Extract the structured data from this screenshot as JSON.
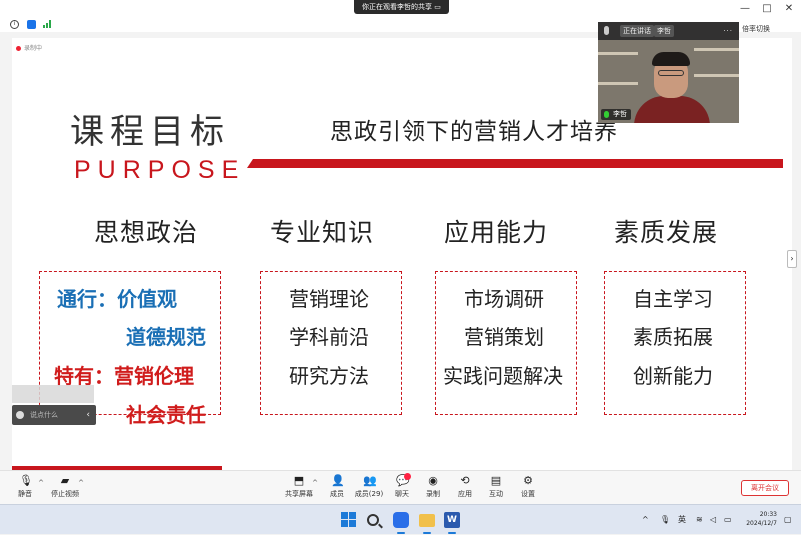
{
  "window": {
    "share_banner": "你正在观看李哲的共享  ▭",
    "controls": {
      "minimize": "—",
      "maximize": "□",
      "close": "✕"
    }
  },
  "recording": {
    "label": "录制中"
  },
  "slide": {
    "title_cn": "课程目标",
    "title_en": "PURPOSE",
    "subtitle": "思政引领下的营销人才培养",
    "accent_color": "#c8161d",
    "columns": [
      {
        "heading": "思想政治",
        "items": [
          {
            "text": "通行：价值观",
            "style": "blue"
          },
          {
            "text": "道德规范",
            "style": "blue"
          },
          {
            "text": "特有：营销伦理",
            "style": "red"
          },
          {
            "text": "社会责任",
            "style": "red"
          }
        ]
      },
      {
        "heading": "专业知识",
        "items": [
          {
            "text": "营销理论"
          },
          {
            "text": "学科前沿"
          },
          {
            "text": "研究方法"
          }
        ]
      },
      {
        "heading": "应用能力",
        "items": [
          {
            "text": "市场调研"
          },
          {
            "text": "营销策划"
          },
          {
            "text": "实践问题解决"
          }
        ]
      },
      {
        "heading": "素质发展",
        "items": [
          {
            "text": "自主学习"
          },
          {
            "text": "素质拓展"
          },
          {
            "text": "创新能力"
          }
        ]
      }
    ]
  },
  "chat": {
    "placeholder": "说点什么"
  },
  "video": {
    "btn_a": "正在讲话",
    "btn_b": "李哲",
    "more": "···",
    "name": "李哲"
  },
  "right_panel": {
    "label": "倍率切换"
  },
  "toolbar": {
    "mute": "静音",
    "stop_video": "停止视频",
    "share_screen": "共享屏幕",
    "members": "成员",
    "participants": "成员(29)",
    "chat": "聊天",
    "record": "录制",
    "apps": "应用",
    "interact": "互动",
    "settings": "设置",
    "leave": "离开会议"
  },
  "taskbar": {
    "tray_caret": "^",
    "ime": "英",
    "time": "20:33",
    "date": "2024/12/7"
  }
}
